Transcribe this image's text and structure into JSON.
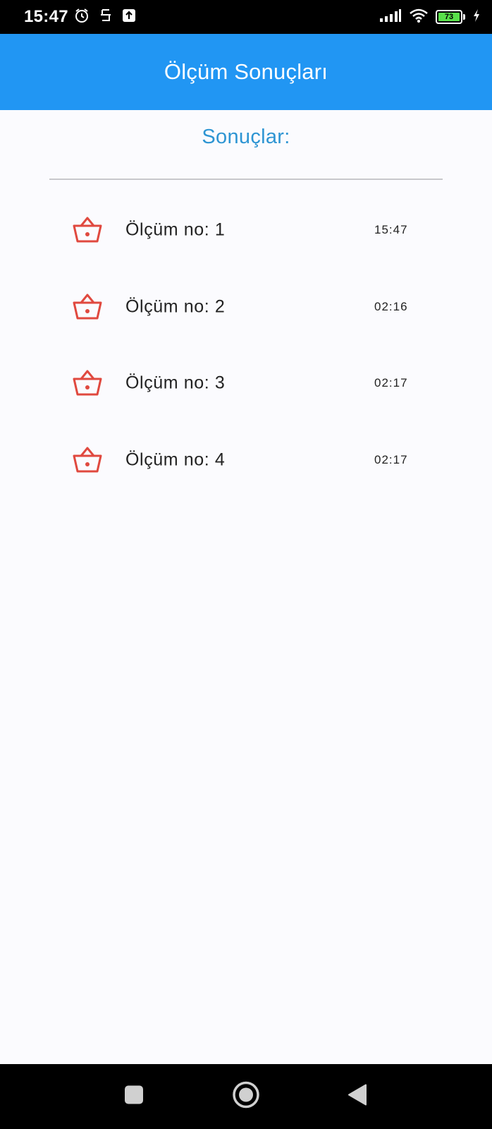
{
  "status_bar": {
    "time": "15:47",
    "battery_level": "73",
    "icons": [
      "alarm-icon",
      "sim-icon",
      "upload-icon",
      "signal-icon",
      "wifi-icon",
      "battery-icon",
      "charging-icon"
    ]
  },
  "app_bar": {
    "title": "Ölçüm Sonuçları",
    "color": "#2196f3"
  },
  "main": {
    "section_title": "Sonuçlar:",
    "section_title_color": "#2e95d3",
    "items": [
      {
        "label": "Ölçüm no: 1",
        "time": "15:47",
        "icon": "basket-icon"
      },
      {
        "label": "Ölçüm no: 2",
        "time": "02:16",
        "icon": "basket-icon"
      },
      {
        "label": "Ölçüm no: 3",
        "time": "02:17",
        "icon": "basket-icon"
      },
      {
        "label": "Ölçüm no: 4",
        "time": "02:17",
        "icon": "basket-icon"
      }
    ],
    "icon_color": "#e0493f"
  },
  "nav_bar": {
    "buttons": [
      "recents-button",
      "home-button",
      "back-button"
    ]
  }
}
